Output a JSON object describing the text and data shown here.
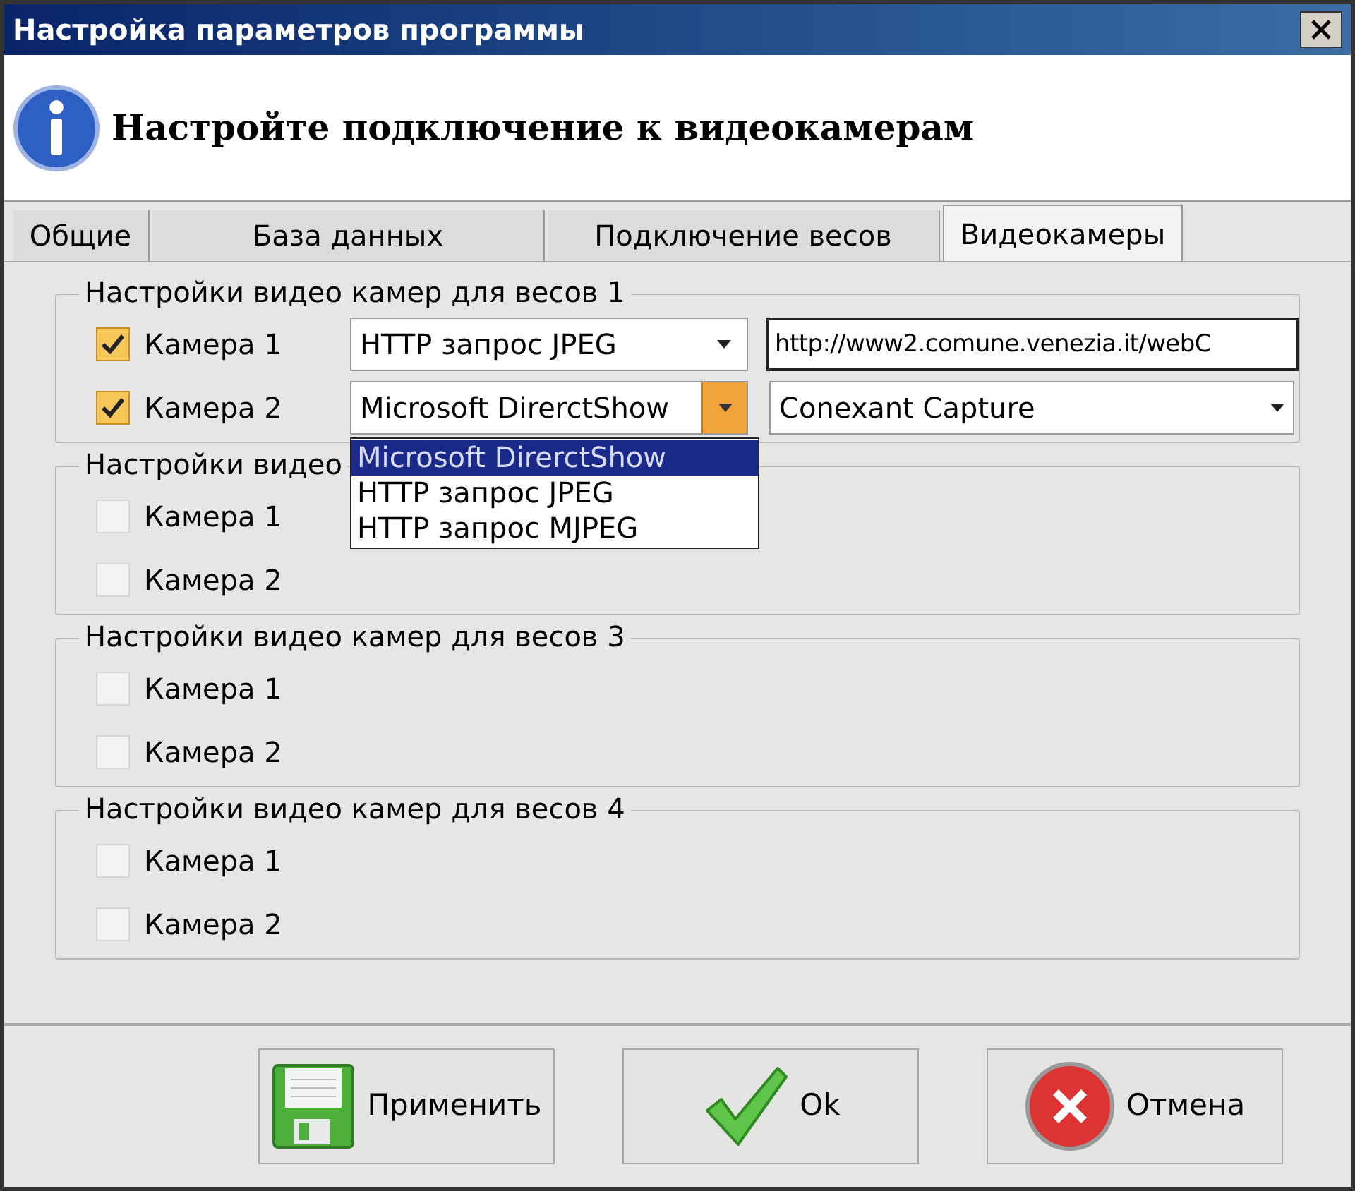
{
  "window": {
    "title": "Настройка параметров программы"
  },
  "header": {
    "text": "Настройте подключение к видеокамерам"
  },
  "tabs": [
    {
      "label": "Общие",
      "selected": false
    },
    {
      "label": "База данных",
      "selected": false
    },
    {
      "label": "Подключение весов",
      "selected": false
    },
    {
      "label": "Видеокамеры",
      "selected": true
    }
  ],
  "groups": [
    {
      "title": "Настройки видео камер для весов 1",
      "cameras": [
        {
          "label": "Камера 1",
          "checked": true,
          "source": {
            "value": "HTTP запрос JPEG",
            "open": false
          },
          "target": {
            "kind": "field",
            "value": "http://www2.comune.venezia.it/webC"
          }
        },
        {
          "label": "Камера 2",
          "checked": true,
          "source": {
            "value": "Microsoft DirerctShow",
            "open": true,
            "options": [
              {
                "label": "Microsoft DirerctShow",
                "selected": true
              },
              {
                "label": "HTTP запрос JPEG",
                "selected": false
              },
              {
                "label": "HTTP запрос MJPEG",
                "selected": false
              }
            ]
          },
          "target": {
            "kind": "select",
            "value": "Conexant Capture"
          }
        }
      ]
    },
    {
      "title": "Настройки видео",
      "cameras": [
        {
          "label": "Камера 1",
          "checked": false
        },
        {
          "label": "Камера 2",
          "checked": false
        }
      ]
    },
    {
      "title": "Настройки видео камер для весов 3",
      "cameras": [
        {
          "label": "Камера 1",
          "checked": false
        },
        {
          "label": "Камера 2",
          "checked": false
        }
      ]
    },
    {
      "title": "Настройки видео камер для весов 4",
      "cameras": [
        {
          "label": "Камера 1",
          "checked": false
        },
        {
          "label": "Камера 2",
          "checked": false
        }
      ]
    }
  ],
  "buttons": [
    {
      "label": "Применить",
      "kind": "save"
    },
    {
      "label": "Ok",
      "kind": "ok"
    },
    {
      "label": "Отмена",
      "kind": "cancel"
    }
  ]
}
